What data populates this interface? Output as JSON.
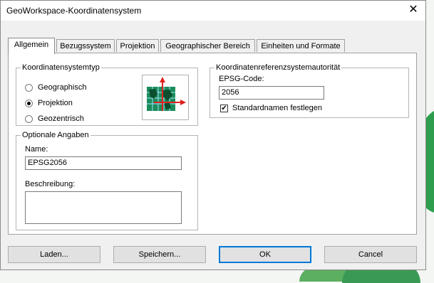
{
  "window": {
    "title": "GeoWorkspace-Koordinatensystem"
  },
  "icons": {
    "close": "close-icon",
    "coordinate": "map-grid-axes-icon"
  },
  "tabs": [
    {
      "label": "Allgemein",
      "active": true
    },
    {
      "label": "Bezugssystem",
      "active": false
    },
    {
      "label": "Projektion",
      "active": false
    },
    {
      "label": "Geographischer Bereich",
      "active": false
    },
    {
      "label": "Einheiten und Formate",
      "active": false
    }
  ],
  "coord_type": {
    "legend": "Koordinatensystemtyp",
    "options": [
      {
        "label": "Geographisch",
        "checked": false
      },
      {
        "label": "Projektion",
        "checked": true
      },
      {
        "label": "Geozentrisch",
        "checked": false
      }
    ]
  },
  "authority": {
    "legend": "Koordinatenreferenzsystemautorität",
    "epsg_label": "EPSG-Code:",
    "epsg_value": "2056",
    "standard_names_label": "Standardnamen festlegen",
    "standard_names_checked": true
  },
  "optional": {
    "legend": "Optionale Angaben",
    "name_label": "Name:",
    "name_value": "EPSG2056",
    "description_label": "Beschreibung:",
    "description_value": ""
  },
  "buttons": {
    "load": "Laden...",
    "save": "Speichern...",
    "ok": "OK",
    "cancel": "Cancel"
  },
  "colors": {
    "accent": "#0078d7",
    "map_green": "#2e9e4e",
    "axis_red": "#e02020"
  }
}
